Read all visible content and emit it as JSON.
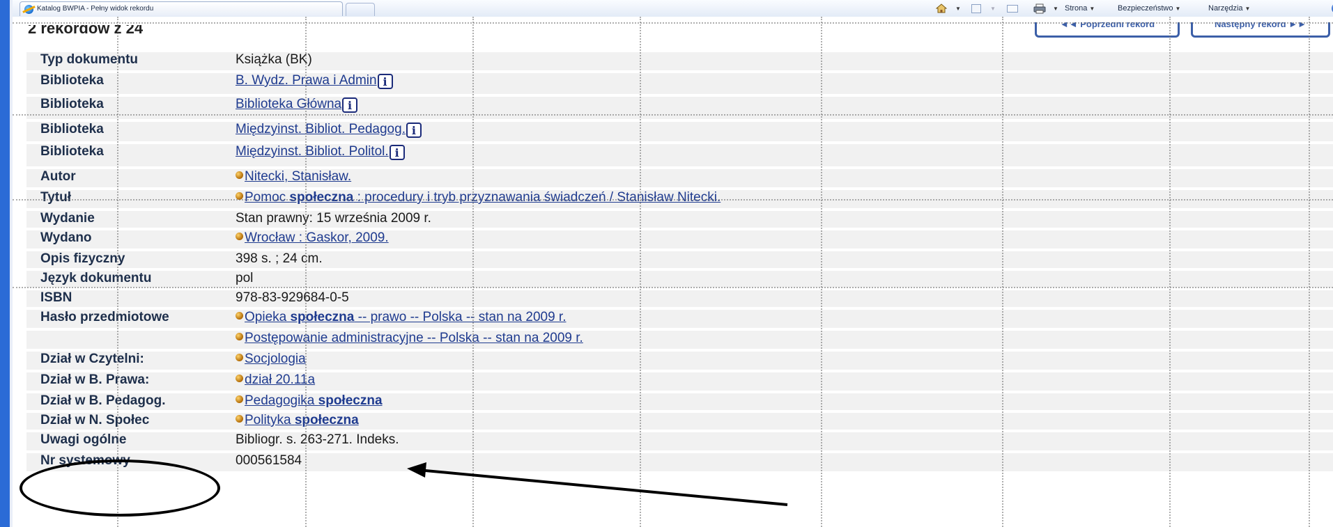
{
  "browser": {
    "tab_title": "Katalog BWPIA - Pełny widok rekordu",
    "commands": {
      "page": "Strona",
      "security": "Bezpieczeństwo",
      "tools": "Narzędzia"
    },
    "icons": [
      "home-icon",
      "feeds-icon",
      "read-mail-icon",
      "print-icon",
      "help-icon"
    ]
  },
  "record": {
    "count_text": "2 rekordów z 24",
    "nav_prev": "◄◄ Poprzedni rekord",
    "nav_next": "Następny rekord ►►",
    "rows": [
      {
        "label": "Typ dokumentu",
        "value": "Książka (BK)"
      },
      {
        "label": "Biblioteka",
        "value": "B. Wydz. Prawa i Admin"
      },
      {
        "label": "Biblioteka",
        "value": "Biblioteka Główna"
      },
      {
        "label": "Biblioteka",
        "value": "Międzyinst. Bibliot. Pedagog."
      },
      {
        "label": "Biblioteka",
        "value": "Międzyinst. Bibliot. Politol."
      },
      {
        "label": "Autor",
        "value": "Nitecki, Stanisław."
      },
      {
        "label": "Tytuł",
        "value_pre": "Pomoc ",
        "value_bold": "społeczna",
        "value_post": " : procedury i tryb przyznawania świadczeń / Stanisław Nitecki."
      },
      {
        "label": "Wydanie",
        "value": "Stan prawny: 15 września 2009 r."
      },
      {
        "label": "Wydano",
        "value": "Wrocław : Gaskor, 2009."
      },
      {
        "label": "Opis fizyczny",
        "value": "398 s. ; 24 cm."
      },
      {
        "label": "Język dokumentu",
        "value": "pol"
      },
      {
        "label": "ISBN",
        "value": "978-83-929684-0-5"
      },
      {
        "label": "Hasło przedmiotowe",
        "value_pre": "Opieka ",
        "value_bold": "społeczna",
        "value_post": " -- prawo -- Polska -- stan na 2009 r."
      },
      {
        "label": "",
        "value": "Postępowanie administracyjne -- Polska -- stan na 2009 r."
      },
      {
        "label": "Dział w Czytelni:",
        "value": "Socjologia"
      },
      {
        "label": "Dział w B. Prawa:",
        "value": "dział 20.11a"
      },
      {
        "label": "Dział w B. Pedagog.",
        "value_pre": "Pedagogika ",
        "value_bold": "społeczna",
        "value_post": ""
      },
      {
        "label": "Dział w N. Społec",
        "value_pre": "Polityka ",
        "value_bold": "społeczna",
        "value_post": ""
      },
      {
        "label": "Uwagi ogólne",
        "value": "Bibliogr. s. 263-271. Indeks."
      },
      {
        "label": "Nr systemowy",
        "value": "000561584"
      }
    ],
    "info_icon_glyph": "i"
  },
  "annotation": {
    "highlight_color": "#000000"
  }
}
